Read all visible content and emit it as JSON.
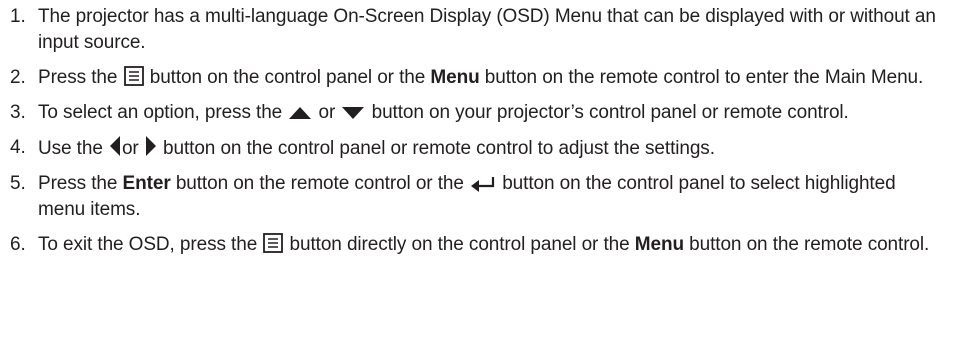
{
  "steps": [
    {
      "num": "1.",
      "text": "The projector has a multi-language On-Screen Display (OSD) Menu that can be displayed with or without an input source."
    },
    {
      "num": "2.",
      "a": "Press the",
      "icon1": "menu-icon",
      "b": "button on the control panel or the",
      "bold": "Menu",
      "c": "button on the remote control to enter the Main Menu."
    },
    {
      "num": "3.",
      "a": "To select an option, press the",
      "icon1": "up-triangle-icon",
      "b": "or",
      "icon2": "down-triangle-icon",
      "c": "button on your projector’s control panel or remote control."
    },
    {
      "num": "4.",
      "a": "Use the",
      "icon1": "left-triangle-icon",
      "b": "or",
      "icon2": "right-triangle-icon",
      "c": "button on the control panel or remote control to adjust the settings."
    },
    {
      "num": "5.",
      "a": "Press the",
      "bold": "Enter",
      "b": "button on the remote control or the",
      "icon1": "enter-arrow-icon",
      "c": "button on the control panel to select highlighted menu items."
    },
    {
      "num": "6.",
      "a": "To exit the OSD, press the",
      "icon1": "menu-icon",
      "b": "button directly on the control panel or the",
      "bold": "Menu",
      "c": "button on the remote control."
    }
  ]
}
